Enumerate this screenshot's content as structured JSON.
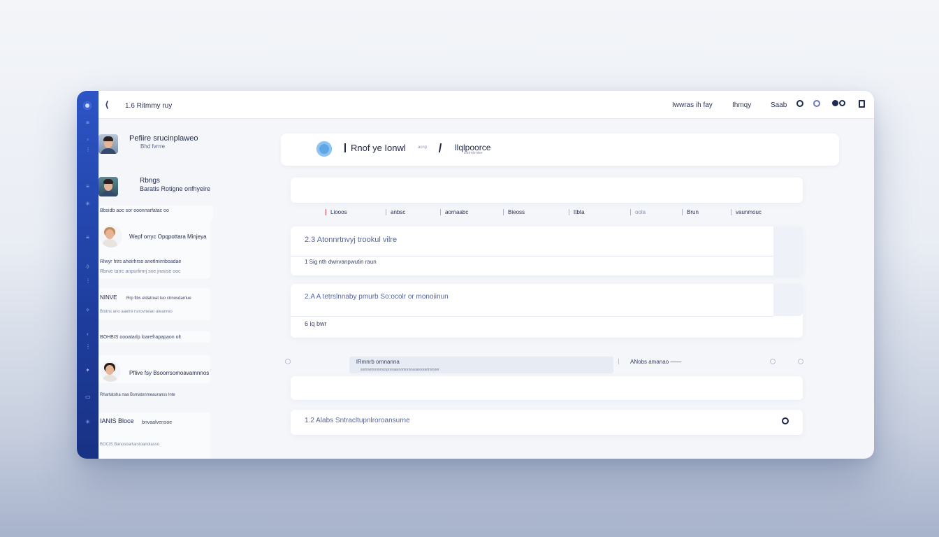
{
  "window": {
    "title": "1.6 Ritmmy ruy",
    "nav": [
      "Iwwras ih fay",
      "Ihmqy",
      "Saab"
    ]
  },
  "sidebar": {
    "profiles": [
      {
        "name": "Pefiire srucinplaweo",
        "sub": "Bhd fvrrre"
      },
      {
        "name": "Rbngs",
        "sub": "Baratis Rotigne onfhyeire"
      }
    ],
    "cards": [
      {
        "lines": [
          "Bbsidb aoc sor ooonnarfatac oo"
        ]
      },
      {
        "title": "Wepf orryc Opqpottara Minjeya",
        "lines": [
          "Rlwyr htrs aheirhrso anetlmirriboadae",
          "Rbrve tarrc anpurlimrj sxe jnavse ooc"
        ]
      },
      {
        "title": "NINVE",
        "lines": [
          "Rrp  fibs  etdatruat tuo ctrnosdarriue",
          "Btotns  ano  aaetre rsnovneiao ateanreo"
        ]
      },
      {
        "lines": [
          "BOHBIS  oooatarlp loarefrapapaon olt"
        ]
      },
      {
        "title": "Pflive  fsy  Bsoorrsomoavamnnos",
        "lines": [
          "Rhartatoha naa Bsmatonmeauranss lnte"
        ]
      },
      {
        "title": "IANIS Bloce",
        "sub": "bnvaalvensoe",
        "lines": [
          "BOCIS  Banosoartarstoanolasso"
        ]
      }
    ]
  },
  "header": {
    "title": "Rnof ye Ionwl",
    "title_sub": "acnp",
    "crumb": "llqlpoorce",
    "crumb_sub": "ictrtrnbrntee"
  },
  "tabs": [
    "Liooos",
    "anbsc",
    "aornaabc",
    "Bieoss",
    "ttbta",
    "oola",
    "Brun",
    "vaunmouc"
  ],
  "rows": [
    {
      "title": "2.3 Atonnrtnvyj trookul vilre",
      "sub": "1 Sig  nth  dwnvanpwutin  raun"
    },
    {
      "title": "2.A A tetrslnnaby pmurb So:ocolr or monoiinun",
      "sub": "6 iq  bwr"
    }
  ],
  "bar": {
    "left": "lRmnrb  ornnanna",
    "left_sub": "snrtrwrmmmmcnpnnraarnomnrnnaoaroorartmmonr",
    "right": "ANobs  amanao  ——"
  },
  "bottom_row": {
    "title": "1.2 Alabs  Sntracltupnlroroansurne"
  },
  "icons": {
    "rail": [
      "logo-icon",
      "menu-icon",
      "doc-icon",
      "list-icon",
      "grid-icon",
      "star-icon",
      "chart-icon",
      "bell-icon",
      "user-icon",
      "clip-icon",
      "folder-icon",
      "gear-icon",
      "help-icon",
      "chat-icon"
    ],
    "accent": "#2c54c4"
  }
}
